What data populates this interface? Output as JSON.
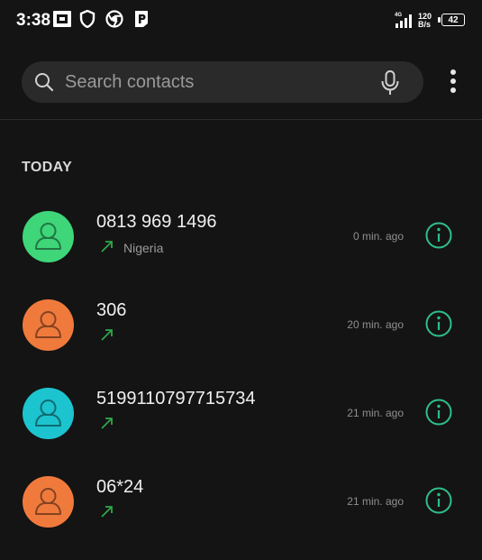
{
  "status_bar": {
    "time": "3:38",
    "network_type": "4G",
    "net_speed_value": "120",
    "net_speed_unit": "B/s",
    "battery": "42"
  },
  "search": {
    "placeholder": "Search contacts"
  },
  "section": {
    "title": "TODAY"
  },
  "colors": {
    "accent_green": "#2fbf8a",
    "arrow_green": "#2ea84a",
    "avatar_green": "#3ed679",
    "avatar_orange": "#f07a3c",
    "avatar_cyan": "#1cc4cf"
  },
  "calls": [
    {
      "number": "0813 969 1496",
      "location": "Nigeria",
      "time": "0 min. ago",
      "avatar_color": "#3ed679",
      "direction_icon": "outgoing-call-arrow-icon"
    },
    {
      "number": "306",
      "location": "",
      "time": "20 min. ago",
      "avatar_color": "#f07a3c",
      "direction_icon": "outgoing-call-arrow-icon"
    },
    {
      "number": "5199110797715734",
      "location": "",
      "time": "21 min. ago",
      "avatar_color": "#1cc4cf",
      "direction_icon": "outgoing-call-arrow-icon"
    },
    {
      "number": "06*24",
      "location": "",
      "time": "21 min. ago",
      "avatar_color": "#f07a3c",
      "direction_icon": "outgoing-call-arrow-icon"
    }
  ]
}
